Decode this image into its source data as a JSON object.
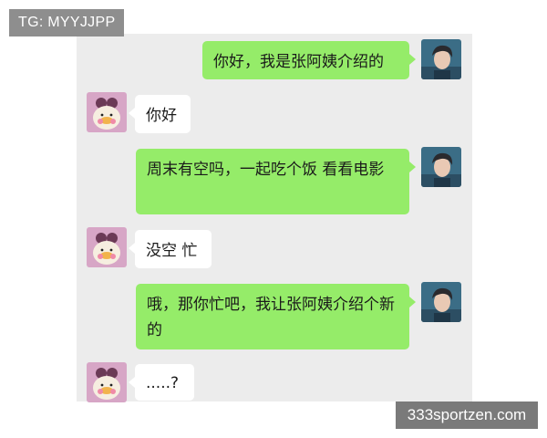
{
  "watermarks": {
    "top_left": "TG: MYYJJPP",
    "bottom_right": "333sportzen.com"
  },
  "colors": {
    "sent_bubble": "#95ec69",
    "received_bubble": "#ffffff",
    "chat_background": "#ececec"
  },
  "messages": [
    {
      "from": "me",
      "avatar": "man-avatar",
      "text": "你好，我是张阿姨介绍的"
    },
    {
      "from": "other",
      "avatar": "duck-avatar",
      "text": "你好"
    },
    {
      "from": "me",
      "avatar": "man-avatar",
      "text": "周末有空吗，一起吃个饭 看看电影"
    },
    {
      "from": "other",
      "avatar": "duck-avatar",
      "text": "没空 忙"
    },
    {
      "from": "me",
      "avatar": "man-avatar",
      "text": "哦，那你忙吧，我让张阿姨介绍个新的"
    },
    {
      "from": "other",
      "avatar": "duck-avatar",
      "text": ".....?"
    }
  ]
}
